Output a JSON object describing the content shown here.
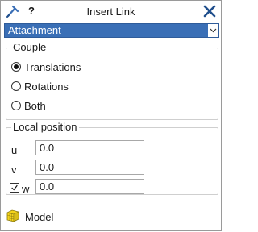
{
  "window": {
    "title": "Insert Link",
    "help": "?"
  },
  "type_select": {
    "value": "Attachment"
  },
  "couple": {
    "title": "Couple",
    "options": [
      {
        "label": "Translations",
        "checked": true
      },
      {
        "label": "Rotations",
        "checked": false
      },
      {
        "label": "Both",
        "checked": false
      }
    ]
  },
  "local_position": {
    "title": "Local position",
    "u": {
      "label": "u",
      "value": "0.0"
    },
    "v": {
      "label": "v",
      "value": "0.0"
    },
    "w": {
      "label": "w",
      "value": "0.0",
      "checked": true
    }
  },
  "footer": {
    "label": "Model"
  },
  "colors": {
    "accent": "#3a6fb6",
    "model_icon": "#f5d41a"
  }
}
